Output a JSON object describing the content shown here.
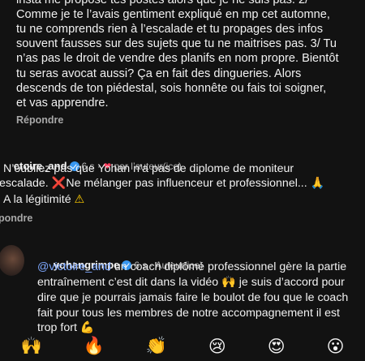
{
  "comment1": {
    "lines": [
      "insta me propose tes postes alors que je ne suis pas. 2/",
      "Comme je te l’avais gentiment expliqué en mp cet automne,",
      "tu ne comprends rien à l’escalade et tu propages des infos",
      "souvent fausses sur des sujets que tu ne maitrises pas. 3/ Tu",
      "n’as pas le droit de vendre des planifs en nom propre. Bientôt",
      "tu seras avocat aussi? Ça en fait des dingueries. Alors",
      "descends de ton piédestal, sois honnête ou fais toi soigner,",
      "et vas apprendre."
    ],
    "reply_label": "Répondre"
  },
  "comment2": {
    "username": "ctoire_and",
    "time": "6 s",
    "separator": "·",
    "liked_by_author": "par l’auteur(ice)",
    "line1": "N’oubliez pas que Yohan n’a pas de diplome de moniteur",
    "line2_a": "escalade. ",
    "line2_b": "Ne mélanger pas influenceur et professionnel... ",
    "line3": "A la légitimité ",
    "reply_label": "pondre"
  },
  "comment3": {
    "username": "yohangrimpe",
    "time": "6 s",
    "separator": "·",
    "author_tag": "Auteur(ice)",
    "mention": "@victoire_and",
    "line1_rest": " un coach diplômé professionnel gère la partie",
    "line2_a": "entraînement c’est dit dans la vidéo ",
    "line2_b": " je suis d’accord pour",
    "line3": "dire que je pourrais jamais faire le boulot de fou que le coach",
    "line4": "fait pour tous les membres de notre accompagnement il est",
    "line5": "trop fort "
  },
  "icons": {
    "cross": "❌",
    "praying": "🙏",
    "warning": "⚠",
    "raised_hands": "🙌",
    "flexed": "💪"
  },
  "reactions": [
    "🙌",
    "🔥",
    "👏",
    "😢",
    "😍",
    "😮"
  ],
  "colors": {
    "background": "#121212",
    "text": "#f1f1f1",
    "muted": "#a8a8a8",
    "mention": "#7ea8ff",
    "heart": "#ff3b5c",
    "verified": "#3897f0"
  }
}
